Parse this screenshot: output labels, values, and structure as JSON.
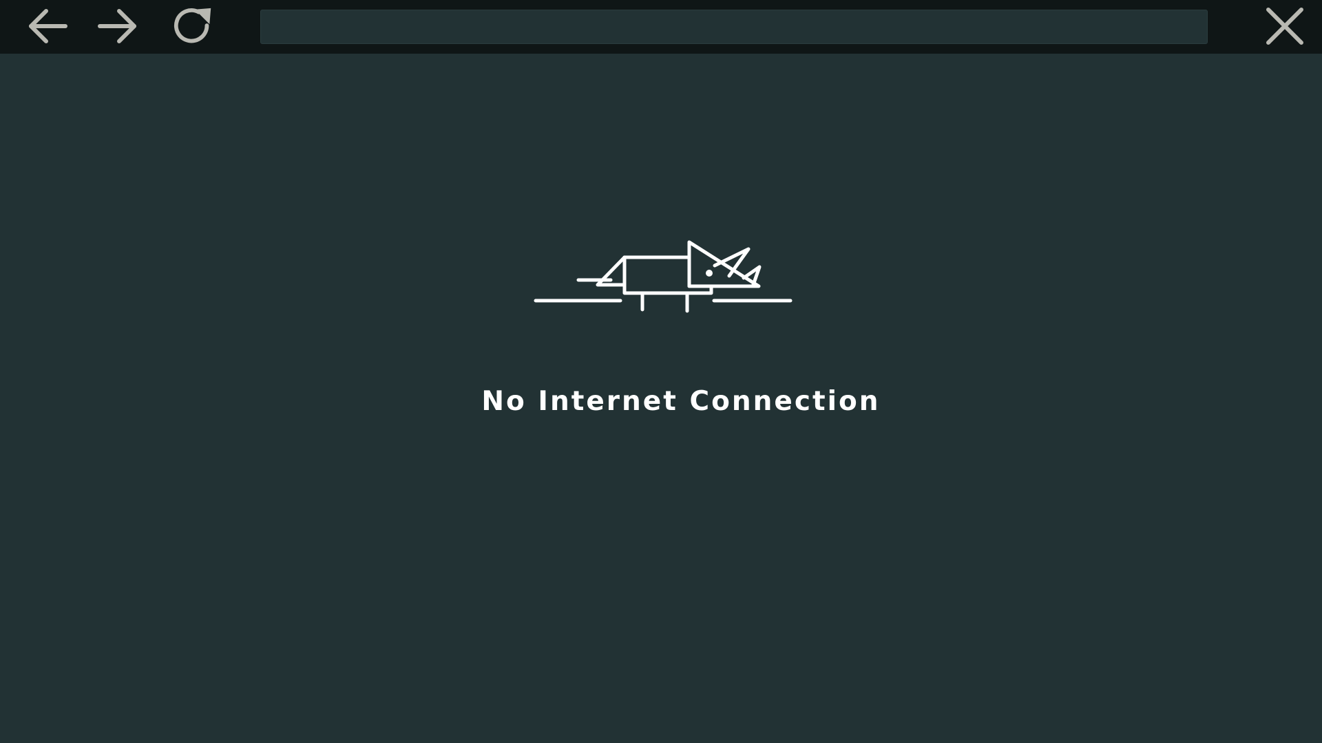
{
  "toolbar": {
    "back_icon": "arrow-left-icon",
    "forward_icon": "arrow-right-icon",
    "reload_icon": "reload-icon",
    "close_icon": "close-icon",
    "address": {
      "value": "",
      "placeholder": ""
    },
    "icon_color": "#b9b9b2"
  },
  "error_page": {
    "illustration_icon": "running-dino-icon",
    "message": "No Internet Connection",
    "text_color": "#ffffff",
    "background": "#223234"
  }
}
